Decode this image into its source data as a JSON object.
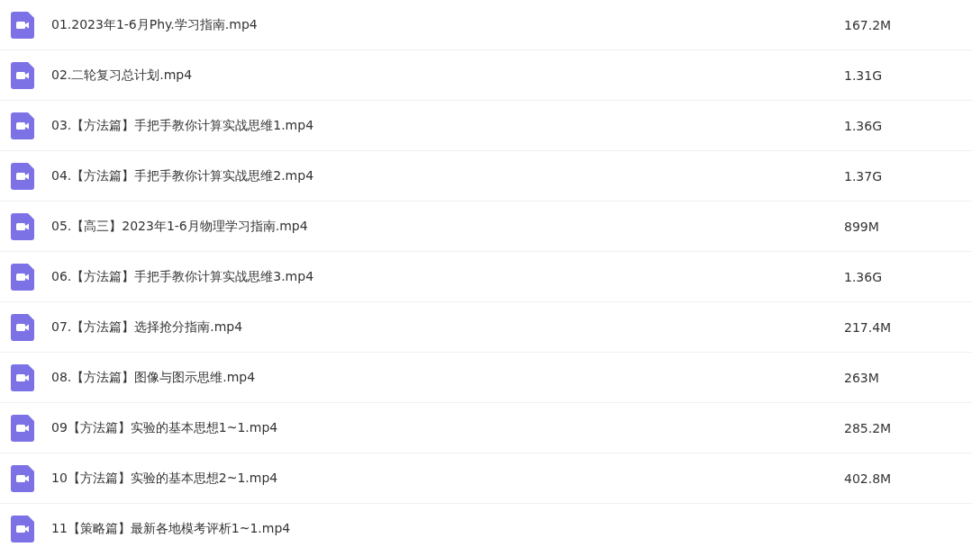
{
  "files": [
    {
      "name": "01.2023年1-6月Phy.学习指南.mp4",
      "size": "167.2M"
    },
    {
      "name": "02.二轮复习总计划.mp4",
      "size": "1.31G"
    },
    {
      "name": "03.【方法篇】手把手教你计算实战思维1.mp4",
      "size": "1.36G"
    },
    {
      "name": "04.【方法篇】手把手教你计算实战思维2.mp4",
      "size": "1.37G"
    },
    {
      "name": "05.【高三】2023年1-6月物理学习指南.mp4",
      "size": "899M"
    },
    {
      "name": "06.【方法篇】手把手教你计算实战思维3.mp4",
      "size": "1.36G"
    },
    {
      "name": "07.【方法篇】选择抢分指南.mp4",
      "size": "217.4M"
    },
    {
      "name": "08.【方法篇】图像与图示思维.mp4",
      "size": "263M"
    },
    {
      "name": "09【方法篇】实验的基本思想1~1.mp4",
      "size": "285.2M"
    },
    {
      "name": "10【方法篇】实验的基本思想2~1.mp4",
      "size": "402.8M"
    },
    {
      "name": "11【策略篇】最新各地模考评析1~1.mp4"
    }
  ]
}
